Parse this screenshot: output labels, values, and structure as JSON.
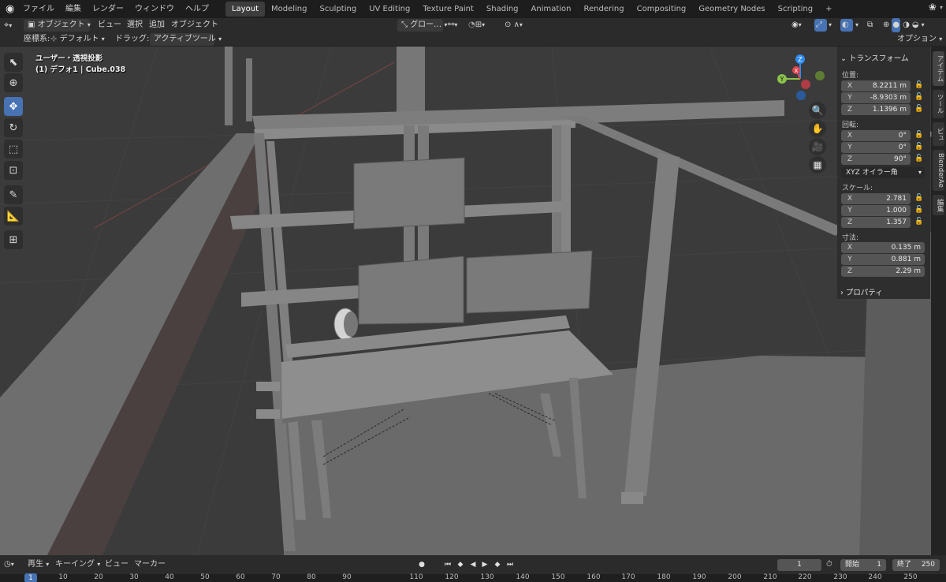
{
  "menubar": {
    "items": [
      "ファイル",
      "編集",
      "レンダー",
      "ウィンドウ",
      "ヘルプ"
    ]
  },
  "workspaces": {
    "tabs": [
      "Layout",
      "Modeling",
      "Sculpting",
      "UV Editing",
      "Texture Paint",
      "Shading",
      "Animation",
      "Rendering",
      "Compositing",
      "Geometry Nodes",
      "Scripting"
    ],
    "add": "+"
  },
  "header": {
    "mode": "オブジェクト",
    "view": "ビュー",
    "select": "選択",
    "add": "追加",
    "object": "オブジェクト",
    "transform_orientation": "グロー…"
  },
  "tool_settings": {
    "coord_label": "座標系:",
    "coord_value": "デフォルト",
    "drag_label": "ドラッグ:",
    "drag_value": "アクティブツール",
    "options": "オプション"
  },
  "viewport": {
    "view_name": "ユーザー・透視投影",
    "object_info": "(1) デフォ1 | Cube.038",
    "gizmo": {
      "x": "X",
      "y": "Y",
      "z": "Z"
    },
    "colors": {
      "bg": "#3b3b3b",
      "floor": "#6a6a6a",
      "mesh": "#787878",
      "axis_x": "#e0444f",
      "axis_y": "#8bc34a",
      "axis_z": "#2f8cf0"
    }
  },
  "npanel": {
    "transform_title": "トランスフォーム",
    "location_label": "位置:",
    "location": [
      {
        "axis": "X",
        "value": "8.2211 m"
      },
      {
        "axis": "Y",
        "value": "-8.9303 m"
      },
      {
        "axis": "Z",
        "value": "1.1396 m"
      }
    ],
    "rotation_label": "回転:",
    "rotation": [
      {
        "axis": "X",
        "value": "0°"
      },
      {
        "axis": "Y",
        "value": "0°"
      },
      {
        "axis": "Z",
        "value": "90°"
      }
    ],
    "rotation_mode": "XYZ オイラー角",
    "scale_label": "スケール:",
    "scale": [
      {
        "axis": "X",
        "value": "2.781"
      },
      {
        "axis": "Y",
        "value": "1.000"
      },
      {
        "axis": "Z",
        "value": "1.357"
      }
    ],
    "dimensions_label": "寸法:",
    "dimensions": [
      {
        "axis": "X",
        "value": "0.135 m"
      },
      {
        "axis": "Y",
        "value": "0.881 m"
      },
      {
        "axis": "Z",
        "value": "2.29 m"
      }
    ],
    "properties_title": "プロパティ"
  },
  "sidetabs": [
    "アイテム",
    "ツール",
    "ビュー",
    "BlenderAe",
    "編集"
  ],
  "timeline": {
    "playback": "再生",
    "keying": "キーイング",
    "view": "ビュー",
    "marker": "マーカー",
    "current_frame": "1",
    "start_label": "開始",
    "start": "1",
    "end_label": "終了",
    "end": "250"
  },
  "frame_ruler": {
    "current": "1",
    "ticks": [
      "10",
      "20",
      "30",
      "40",
      "50",
      "60",
      "70",
      "80",
      "90",
      "110",
      "120",
      "130",
      "140",
      "150",
      "160",
      "170",
      "180",
      "190",
      "200",
      "210",
      "220",
      "230",
      "240",
      "250"
    ]
  }
}
